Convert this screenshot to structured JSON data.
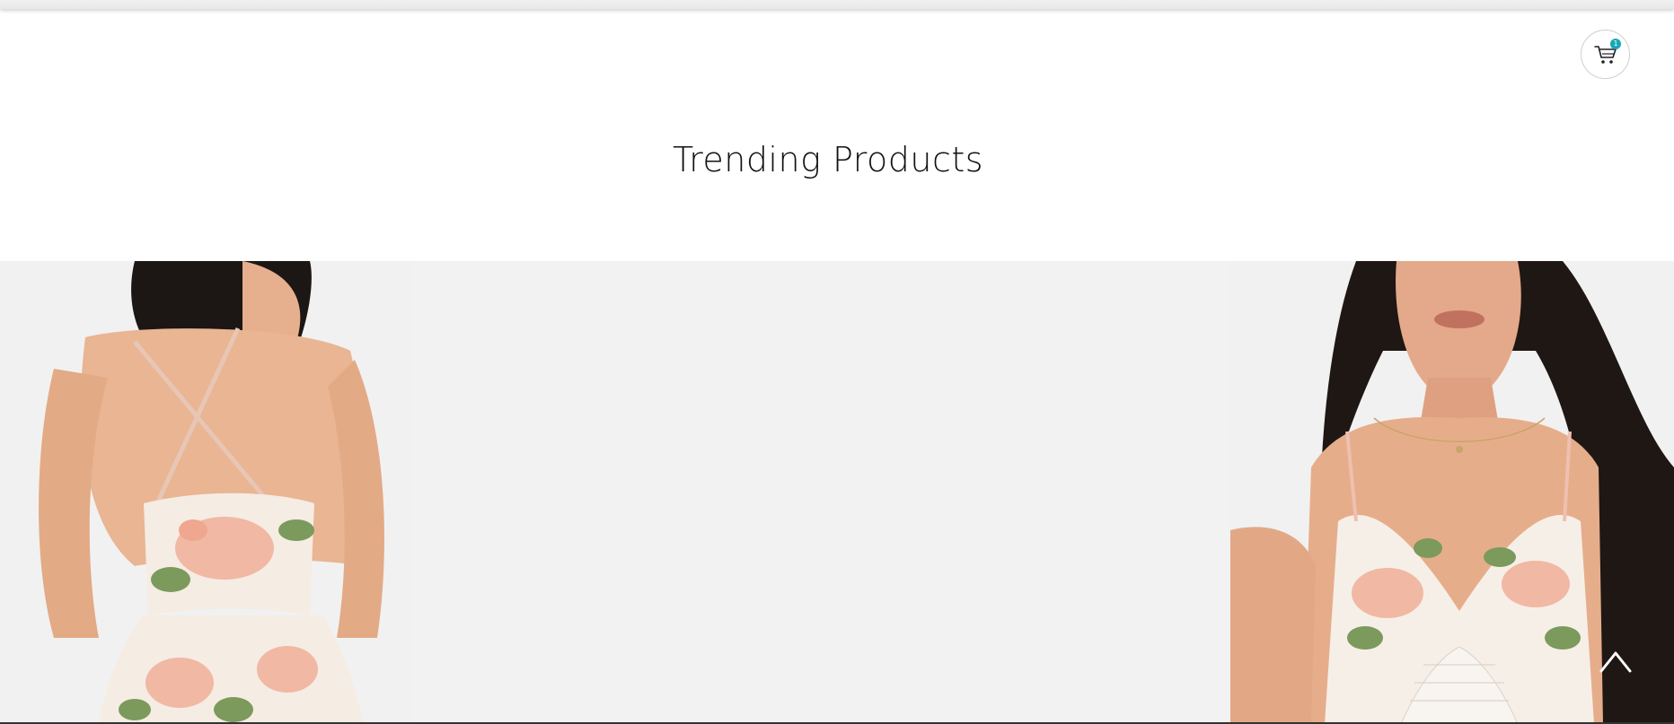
{
  "header": {
    "cart": {
      "icon": "cart-icon",
      "count": "1",
      "badge_color": "#1aa6b7"
    }
  },
  "main": {
    "title": "Trending Products",
    "products": [
      {
        "image": "floral-dress-back-view"
      },
      {
        "image": "floral-dress-front-view"
      }
    ]
  },
  "controls": {
    "scroll_top_icon": "chevron-up-icon"
  }
}
